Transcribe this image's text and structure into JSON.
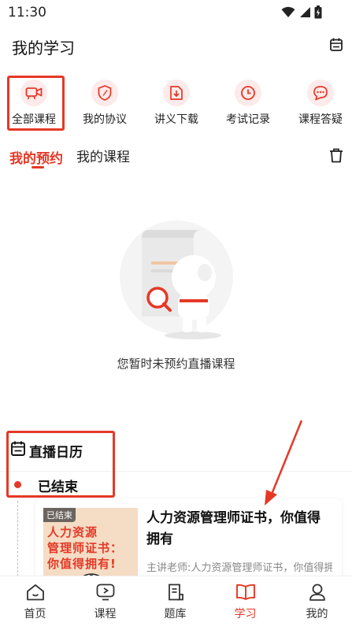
{
  "status_bar": {
    "time": "11:30"
  },
  "header": {
    "title": "我的学习"
  },
  "quick_nav": [
    {
      "label": "全部课程",
      "icon": "video-camera-icon"
    },
    {
      "label": "我的协议",
      "icon": "shield-pen-icon"
    },
    {
      "label": "讲义下载",
      "icon": "download-doc-icon"
    },
    {
      "label": "考试记录",
      "icon": "clock-icon"
    },
    {
      "label": "课程答疑",
      "icon": "chat-bubble-icon"
    }
  ],
  "tabs": [
    {
      "label": "我的预约",
      "active": true
    },
    {
      "label": "我的课程",
      "active": false
    }
  ],
  "empty_state": {
    "text": "您暂时未预约直播课程"
  },
  "live_calendar": {
    "title": "直播日历",
    "status_label": "已结束",
    "course": {
      "badge": "已结束",
      "thumb_lines": [
        "人力资源",
        "管理师证书：",
        "你值得拥有!"
      ],
      "title": "人力资源管理师证书，你值得拥有",
      "teacher": "主讲老师:人力资源管理师证书，你值得拥有"
    }
  },
  "tabbar": [
    {
      "label": "首页",
      "icon": "home-icon",
      "active": false
    },
    {
      "label": "课程",
      "icon": "play-icon",
      "active": false
    },
    {
      "label": "题库",
      "icon": "question-bank-icon",
      "active": false
    },
    {
      "label": "学习",
      "icon": "book-icon",
      "active": true
    },
    {
      "label": "我的",
      "icon": "user-icon",
      "active": false
    }
  ],
  "colors": {
    "accent": "#e53826",
    "icon_bg": "#fdeaea",
    "thumb_bg": "#f5dcc4"
  }
}
